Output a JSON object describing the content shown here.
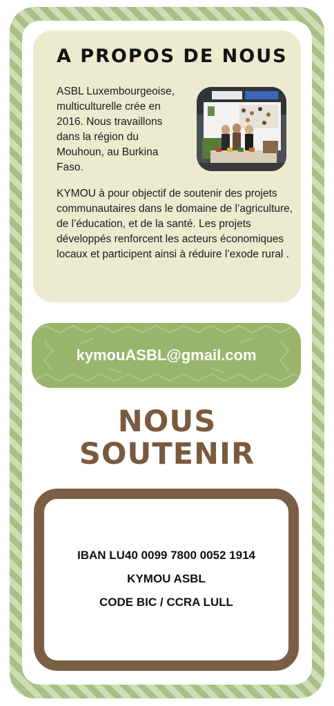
{
  "about": {
    "title": "A PROPOS DE NOUS",
    "intro": "ASBL Luxembourgeoise, multiculturelle crée en 2016. Nous travaillons dans la région du Mouhoun, au Burkina Faso.",
    "description": "KYMOU à pour objectif de soutenir des projets communautaires dans le domaine de l’agriculture,  de l’éducation, et de la santé. Les projets développés renforcent  les acteurs économiques locaux et participent ainsi à réduire  l’exode rural ."
  },
  "contact": {
    "email": "kymouASBL@gmail.com"
  },
  "support": {
    "title_line1": "NOUS",
    "title_line2": "SOUTENIR",
    "iban": "IBAN LU40 0099 7800 0052 1914",
    "account_name": "KYMOU ASBL",
    "bic": "CODE BIC / CCRA LULL"
  },
  "colors": {
    "frame_green": "#a9bf84",
    "about_bg": "#ecebd0",
    "email_green": "#98b56b",
    "brown": "#7a5a3e"
  }
}
